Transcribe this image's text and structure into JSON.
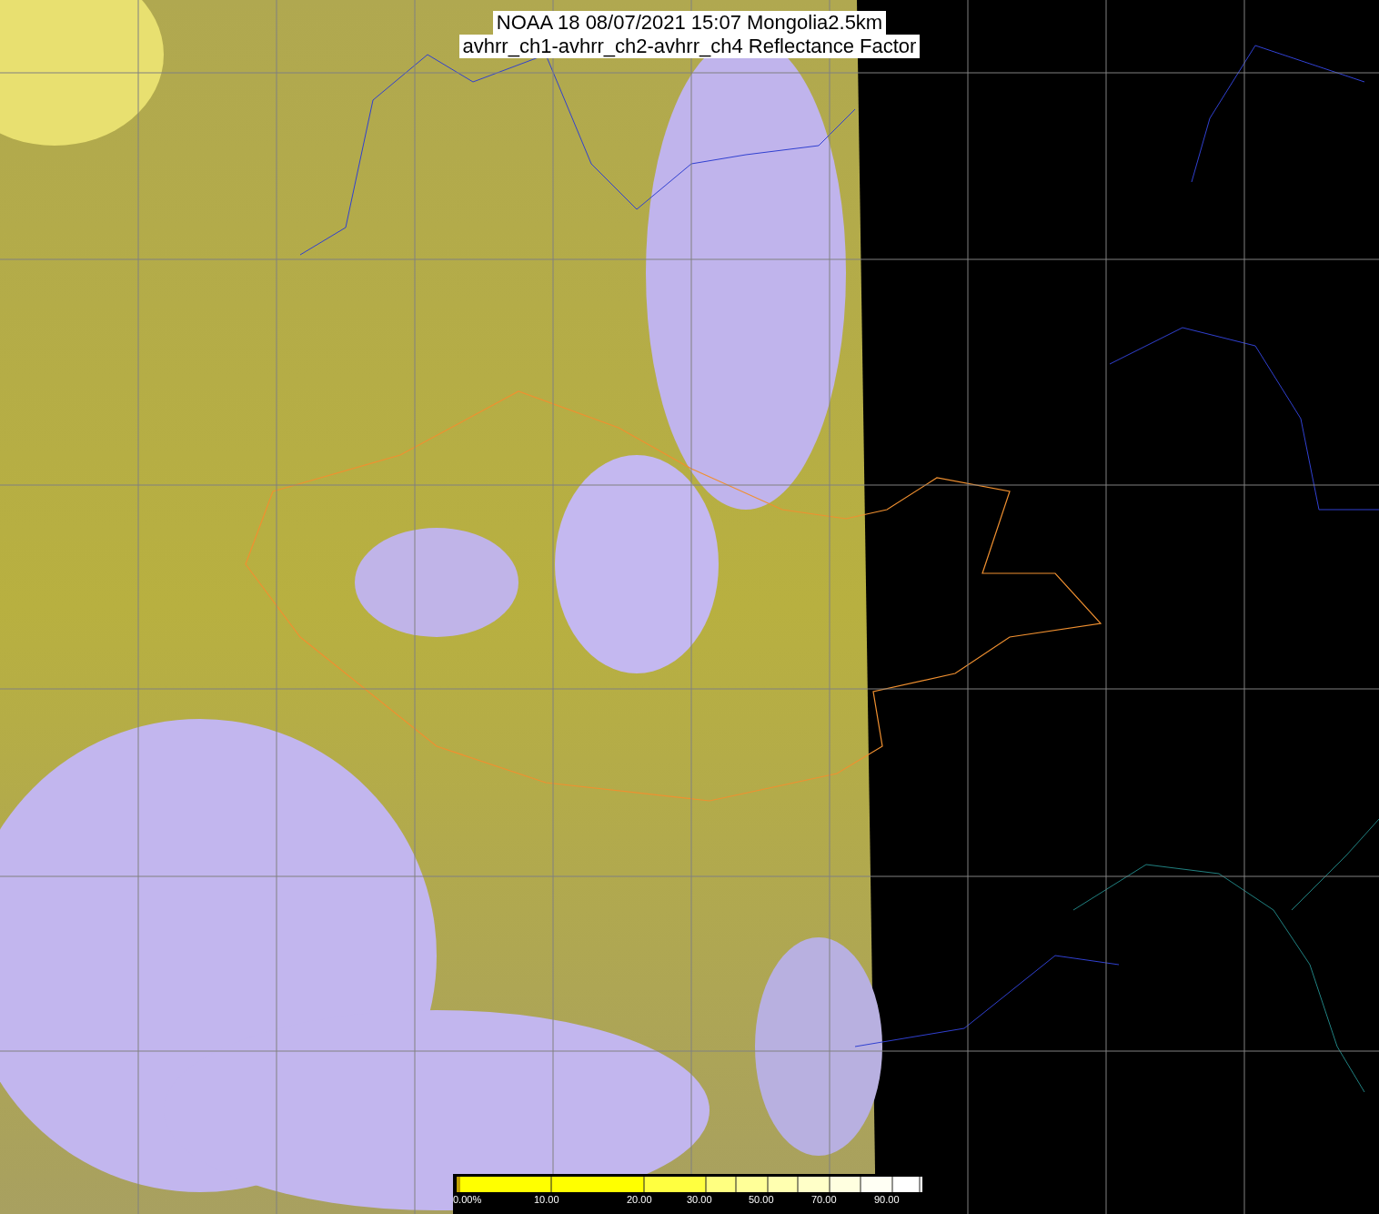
{
  "title": {
    "lines": [
      "NOAA 18 08/07/2021 15:07 Mongolia2.5km",
      "avhrr_ch1-avhrr_ch2-avhrr_ch4 Reflectance Factor"
    ]
  },
  "colorbar": {
    "labels": [
      "0.00%",
      "10.00",
      "20.00",
      "30.00",
      "50.00",
      "70.00",
      "90.00"
    ]
  }
}
